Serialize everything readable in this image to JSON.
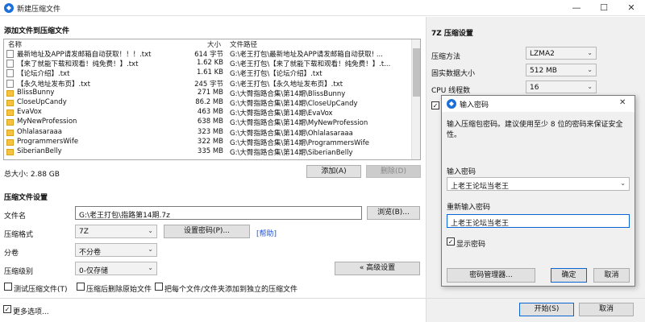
{
  "window": {
    "title": "新建压缩文件",
    "minimize": "—",
    "maximize": "☐",
    "close": "✕"
  },
  "files_section": {
    "title": "添加文件到压缩文件",
    "columns": {
      "name": "名称",
      "size": "大小",
      "path": "文件路径"
    },
    "rows": [
      {
        "type": "file",
        "name": "最新地址及APP请发邮箱自动获取！！！.txt",
        "size": "614 字节",
        "path": "G:\\老王打包\\最新地址及APP请发邮箱自动获取! ..."
      },
      {
        "type": "file",
        "name": "【来了就能下载和观看！纯免费！】.txt",
        "size": "1.62 KB",
        "path": "G:\\老王打包\\【来了就能下载和观看！纯免费！】.t..."
      },
      {
        "type": "file",
        "name": "【论坛介绍】.txt",
        "size": "1.61 KB",
        "path": "G:\\老王打包\\【论坛介绍】.txt"
      },
      {
        "type": "file",
        "name": "【永久地址发布页】.txt",
        "size": "245 字节",
        "path": "G:\\老王打包\\【永久地址发布页】.txt"
      },
      {
        "type": "folder",
        "name": "BlissBunny",
        "size": "271 MB",
        "path": "G:\\大臀指路合集\\第14期\\BlissBunny"
      },
      {
        "type": "folder",
        "name": "CloseUpCandy",
        "size": "86.2 MB",
        "path": "G:\\大臀指路合集\\第14期\\CloseUpCandy"
      },
      {
        "type": "folder",
        "name": "EvaVox",
        "size": "463 MB",
        "path": "G:\\大臀指路合集\\第14期\\EvaVox"
      },
      {
        "type": "folder",
        "name": "MyNewProfession",
        "size": "638 MB",
        "path": "G:\\大臀指路合集\\第14期\\MyNewProfession"
      },
      {
        "type": "folder",
        "name": "Ohlalasaraaa",
        "size": "323 MB",
        "path": "G:\\大臀指路合集\\第14期\\Ohlalasaraaa"
      },
      {
        "type": "folder",
        "name": "ProgrammersWife",
        "size": "322 MB",
        "path": "G:\\大臀指路合集\\第14期\\ProgrammersWife"
      },
      {
        "type": "folder",
        "name": "SiberianBelly",
        "size": "335 MB",
        "path": "G:\\大臀指路合集\\第14期\\SiberianBelly"
      }
    ],
    "total_label": "总大小: 2.88 GB",
    "add_button": "添加(A)",
    "delete_button": "删除(D)"
  },
  "compress_settings": {
    "title": "压缩文件设置",
    "filename_label": "文件名",
    "filename_value": "G:\\老王打包\\指路第14期.7z",
    "browse_button": "浏览(B)...",
    "format_label": "压缩格式",
    "format_value": "7Z",
    "set_password_button": "设置密码(P)...",
    "help_link": "[帮助]",
    "split_label": "分卷",
    "split_value": "不分卷",
    "level_label": "压缩级别",
    "level_value": "0-仅存储",
    "advanced_button": "« 高级设置",
    "test_label": "测试压缩文件(T)",
    "delete_after_label": "压缩后删除原始文件",
    "each_separate_label": "把每个文件/文件夹添加到独立的压缩文件",
    "more_options_label": "更多选项...",
    "start_button": "开始(S)",
    "cancel_button": "取消"
  },
  "seven_z_settings": {
    "title": "7Z 压缩设置",
    "method_label": "压缩方法",
    "method_value": "LZMA2",
    "solid_label": "固实数据大小",
    "solid_value": "512 MB",
    "threads_label": "CPU 线程数",
    "threads_value": "16"
  },
  "password_dialog": {
    "title": "输入密码",
    "close": "✕",
    "instruction": "输入压缩包密码。建议使用至少 8 位的密码来保证安全性。",
    "enter_label": "输入密码",
    "enter_value": "上老王论坛当老王",
    "reenter_label": "重新输入密码",
    "reenter_value": "上老王论坛当老王",
    "show_password_label": "显示密码",
    "manager_button": "密码管理器...",
    "ok_button": "确定",
    "cancel_button": "取消"
  }
}
